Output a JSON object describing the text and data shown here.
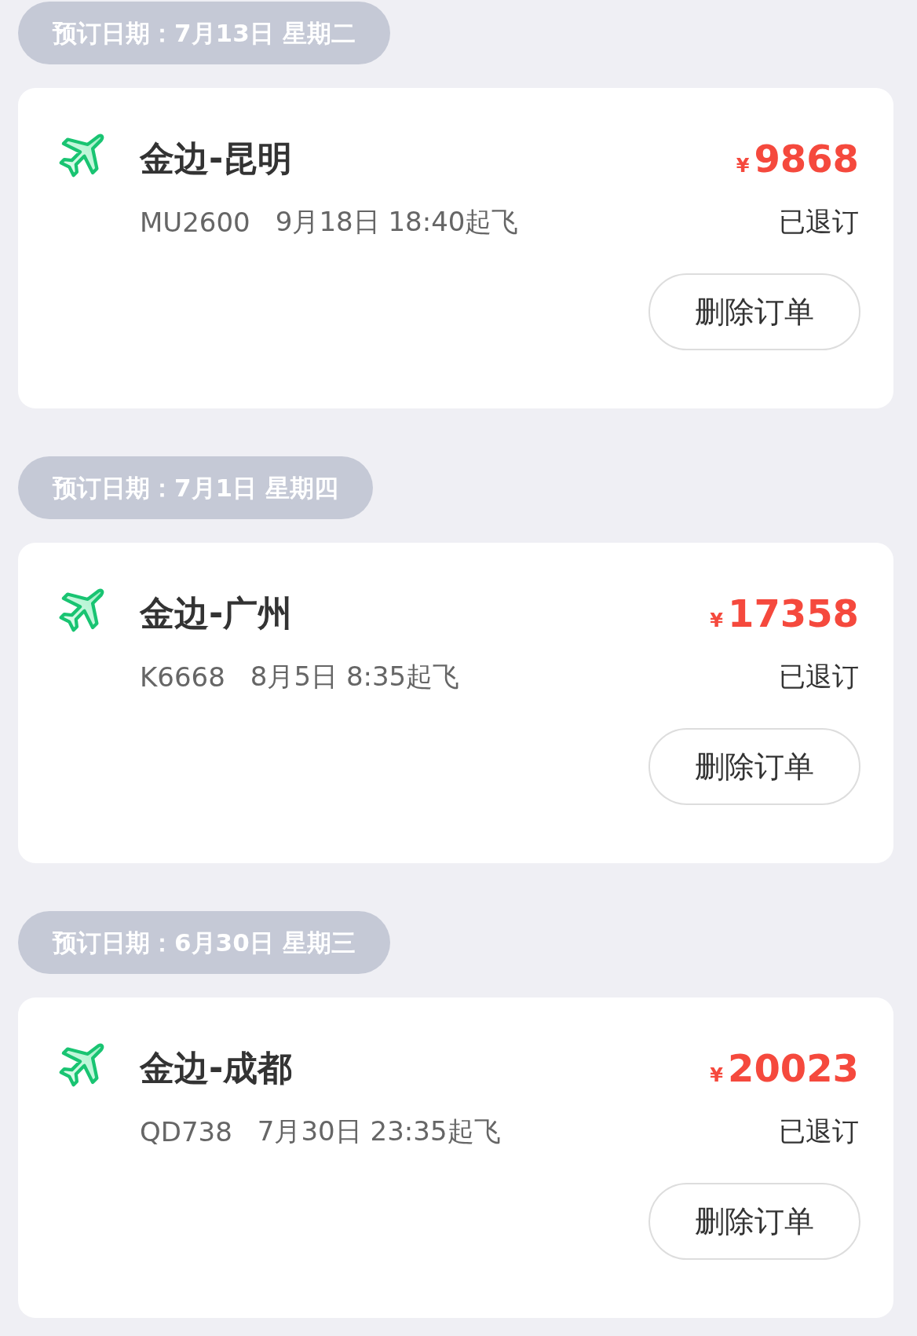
{
  "orders": [
    {
      "booking_date": "预订日期：7月13日 星期二",
      "route": "金边-昆明",
      "currency": "¥",
      "price": "9868",
      "flight_no": "MU2600",
      "departure": "9月18日 18:40起飞",
      "status": "已退订",
      "action": "删除订单"
    },
    {
      "booking_date": "预订日期：7月1日 星期四",
      "route": "金边-广州",
      "currency": "¥",
      "price": "17358",
      "flight_no": "K6668",
      "departure": "8月5日 8:35起飞",
      "status": "已退订",
      "action": "删除订单"
    },
    {
      "booking_date": "预订日期：6月30日 星期三",
      "route": "金边-成都",
      "currency": "¥",
      "price": "20023",
      "flight_no": "QD738",
      "departure": "7月30日 23:35起飞",
      "status": "已退订",
      "action": "删除订单"
    }
  ]
}
